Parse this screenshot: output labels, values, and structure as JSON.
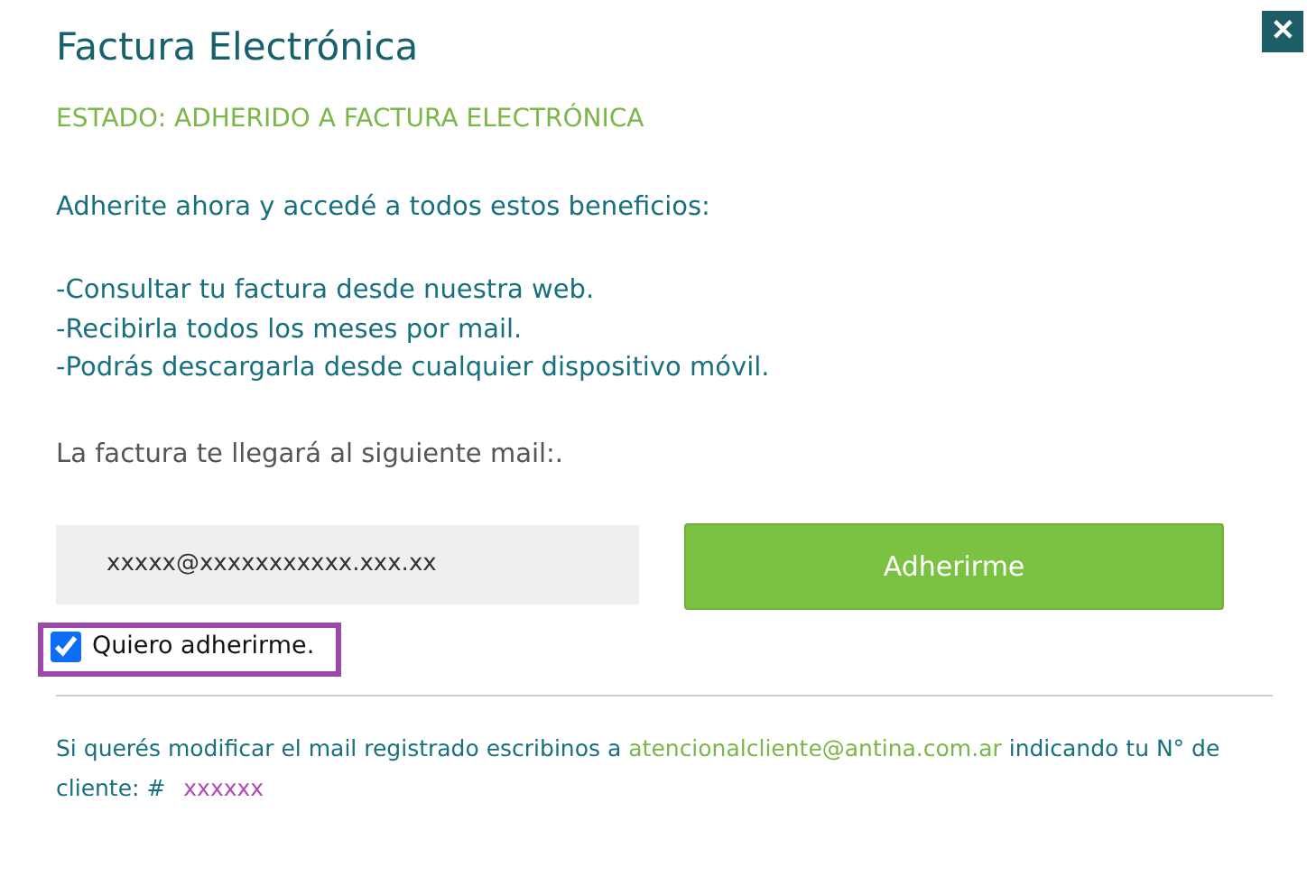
{
  "dialog": {
    "title": "Factura Electrónica",
    "close_label": "✕"
  },
  "status": "ESTADO: ADHERIDO A FACTURA ELECTRÓNICA",
  "intro": "Adherite ahora y accedé a todos estos beneficios:",
  "benefits": [
    "-Consultar tu factura desde nuestra web.",
    "-Recibirla todos los meses por mail.",
    "-Podrás descargarla desde cualquier dispositivo móvil."
  ],
  "mail_label": "La factura te llegará al siguiente mail:.",
  "email_field": {
    "value": "xxxxx@xxxxxxxxxxx.xxx.xx"
  },
  "submit_button": "Adherirme",
  "agree_checkbox": {
    "label": "Quiero adherirme.",
    "checked": true,
    "highlighted": true
  },
  "footer": {
    "text_before": "Si querés modificar el mail registrado escribinos a",
    "email_link": "atencionalcliente@antina.com.ar",
    "text_after": "indicando tu N° de cliente: #",
    "client_number": "xxxxxx"
  }
}
